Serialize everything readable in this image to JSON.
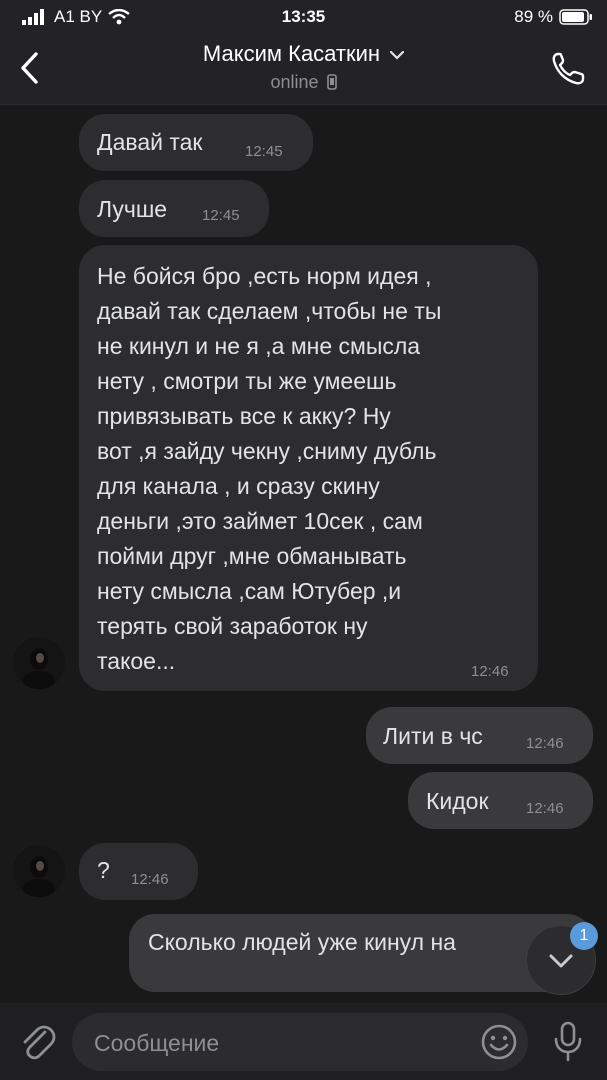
{
  "status_bar": {
    "carrier": "A1 BY",
    "time": "13:35",
    "battery": "89 %"
  },
  "header": {
    "title": "Максим Касаткин",
    "subtitle": "online"
  },
  "messages": [
    {
      "direction": "in",
      "text": "Давай так",
      "time": "12:45"
    },
    {
      "direction": "in",
      "text": "Лучше",
      "time": "12:45"
    },
    {
      "direction": "in",
      "lines": [
        "Не бойся бро ,есть норм идея ,",
        "давай так сделаем ,чтобы не ты",
        "не кинул и не я ,а мне смысла",
        "нету , смотри ты же умеешь",
        "привязывать все к акку? Ну",
        "вот ,я зайду чекну ,сниму дубль",
        "для канала , и сразу скину",
        "деньги ,это займет 10сек , сам",
        "пойми друг ,мне обманывать",
        "нету смысла ,сам Ютубер ,и",
        "терять свой заработок ну",
        "такое..."
      ],
      "time": "12:46"
    },
    {
      "direction": "out",
      "text": "Лити в чс",
      "time": "12:46"
    },
    {
      "direction": "out",
      "text": "Кидок",
      "time": "12:46"
    },
    {
      "direction": "in",
      "text": "?",
      "time": "12:46"
    },
    {
      "direction": "out",
      "text": "Сколько людей уже кинул на"
    }
  ],
  "composer": {
    "placeholder": "Сообщение"
  },
  "unread_badge": "1",
  "icons": [
    "signal-icon",
    "wifi-icon",
    "battery-icon",
    "back-icon",
    "chevron-down-icon",
    "phone-icon",
    "mobile-device-icon",
    "attach-icon",
    "emoji-icon",
    "microphone-icon",
    "scroll-down-icon"
  ]
}
